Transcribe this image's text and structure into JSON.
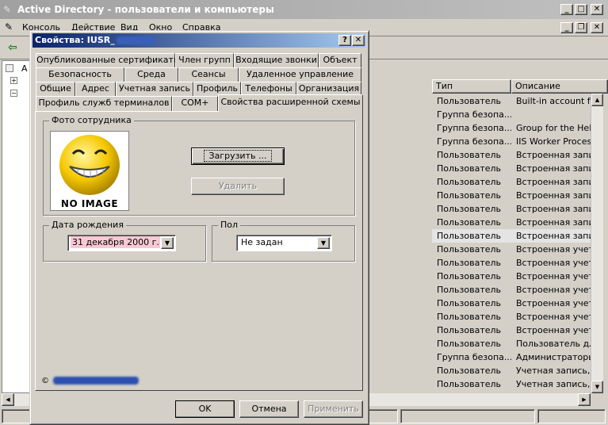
{
  "main_window": {
    "title": "Active Directory - пользователи и компьютеры",
    "menu": [
      "Консоль",
      "Действие",
      "Вид",
      "Окно",
      "Справка"
    ]
  },
  "tree": {
    "items": [
      "A"
    ]
  },
  "list": {
    "columns": [
      "Тип",
      "Описание"
    ],
    "rows": [
      {
        "type": "Пользователь",
        "desc": "Built-in account for"
      },
      {
        "type": "Группа безопа...",
        "desc": ""
      },
      {
        "type": "Группа безопа...",
        "desc": "Group for the Help a"
      },
      {
        "type": "Группа безопа...",
        "desc": "IIS Worker Process"
      },
      {
        "type": "Пользователь",
        "desc": "Встроенная запись"
      },
      {
        "type": "Пользователь",
        "desc": "Встроенная запись"
      },
      {
        "type": "Пользователь",
        "desc": "Встроенная запись"
      },
      {
        "type": "Пользователь",
        "desc": "Встроенная запись"
      },
      {
        "type": "Пользователь",
        "desc": "Встроенная запись"
      },
      {
        "type": "Пользователь",
        "desc": "Встроенная запись"
      },
      {
        "type": "Пользователь",
        "desc": "Встроенная запись"
      },
      {
        "type": "Пользователь",
        "desc": "Встроенная учетна"
      },
      {
        "type": "Пользователь",
        "desc": "Встроенная учетна"
      },
      {
        "type": "Пользователь",
        "desc": "Встроенная учетна"
      },
      {
        "type": "Пользователь",
        "desc": "Встроенная учетна"
      },
      {
        "type": "Пользователь",
        "desc": "Встроенная учетна"
      },
      {
        "type": "Пользователь",
        "desc": "Встроенная учетна"
      },
      {
        "type": "Пользователь",
        "desc": "Встроенная учетна"
      },
      {
        "type": "Пользователь",
        "desc": "Пользователь для"
      },
      {
        "type": "Группа безопа...",
        "desc": "Администраторы д"
      },
      {
        "type": "Пользователь",
        "desc": "Учетная запись, п"
      },
      {
        "type": "Пользователь",
        "desc": "Учетная запись, п"
      }
    ]
  },
  "dialog": {
    "title": "Свойства: IUSR_",
    "help": "?",
    "close": "✕",
    "tab_rows": [
      [
        "Опубликованные сертификаты",
        "Член групп",
        "Входящие звонки",
        "Объект"
      ],
      [
        "Безопасность",
        "Среда",
        "Сеансы",
        "Удаленное управление"
      ],
      [
        "Общие",
        "Адрес",
        "Учетная запись",
        "Профиль",
        "Телефоны",
        "Организация"
      ],
      [
        "Профиль служб терминалов",
        "COM+",
        "Свойства расширенной схемы"
      ]
    ],
    "photo_group": "Фото сотрудника",
    "no_image": "NO IMAGE",
    "load_button": "Загрузить ...",
    "delete_button": "Удалить",
    "birth_group": "Дата рождения",
    "birth_value": "31 декабря 2000 г.",
    "sex_group": "Пол",
    "sex_value": "Не задан",
    "copyright": "©",
    "ok": "OK",
    "cancel": "Отмена",
    "apply": "Применить"
  },
  "colors": {
    "title_active": "#0a246a",
    "title_inactive": "#a0a0a0",
    "date_highlight": "#f7c9d4",
    "face": "#f5c800"
  }
}
